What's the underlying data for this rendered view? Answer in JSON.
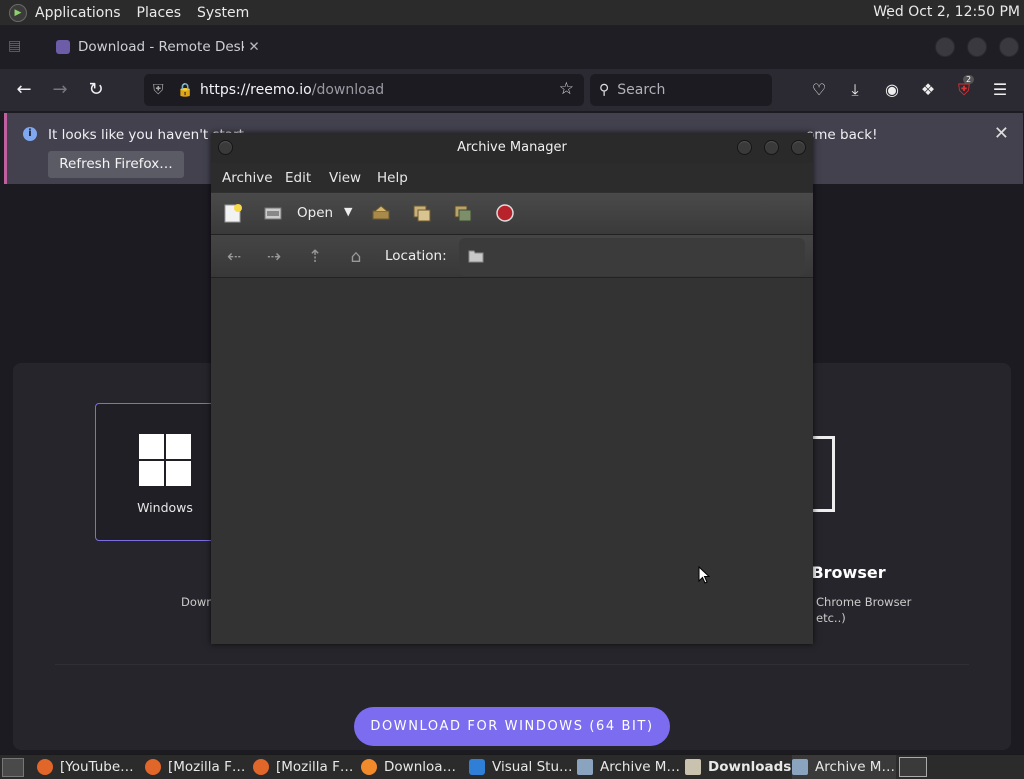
{
  "top_panel": {
    "menus": [
      "Applications",
      "Places",
      "System"
    ],
    "clock": "Wed Oct  2, 12:50 PM"
  },
  "firefox": {
    "tab_title": "Download - Remote Deskto",
    "url_host": "https://reemo.io",
    "url_path": "/download",
    "search_placeholder": "Search",
    "ublock_badge": "2",
    "notification": {
      "message": "It looks like you haven't start    d Firefox in a while. Do you want to clean it up for a fresh, like-new experience? And by the way, welcome back!",
      "message_visible": "It looks like you haven't start",
      "message_tail": "ome back!",
      "refresh_button": "Refresh Firefox…"
    }
  },
  "page": {
    "windows_label": "Windows",
    "down_partial": "Down",
    "browser_title": "r Browser",
    "browser_desc1": "Chrome Browser",
    "browser_desc2": "etc..)",
    "download_button": "DOWNLOAD FOR WINDOWS (64 BIT)"
  },
  "archive_manager": {
    "title": "Archive Manager",
    "menus": [
      "Archive",
      "Edit",
      "View",
      "Help"
    ],
    "toolbar_open": "Open",
    "location_label": "Location:"
  },
  "taskbar": {
    "items": [
      {
        "label": "[YouTube…",
        "icon": "firefox-icon"
      },
      {
        "label": "[Mozilla F…",
        "icon": "firefox-icon"
      },
      {
        "label": "[Mozilla F…",
        "icon": "firefox-icon"
      },
      {
        "label": "Downloa…",
        "icon": "firefox-icon"
      },
      {
        "label": "Visual Stu…",
        "icon": "vscode-icon"
      },
      {
        "label": "Archive M…",
        "icon": "archive-icon"
      },
      {
        "label": "Downloads",
        "icon": "folder-icon"
      },
      {
        "label": "Archive M…",
        "icon": "archive-icon"
      }
    ]
  },
  "colors": {
    "accent": "#7b6cf0",
    "panel": "#2b2b2b",
    "firefox_bg": "#1c1b22"
  }
}
